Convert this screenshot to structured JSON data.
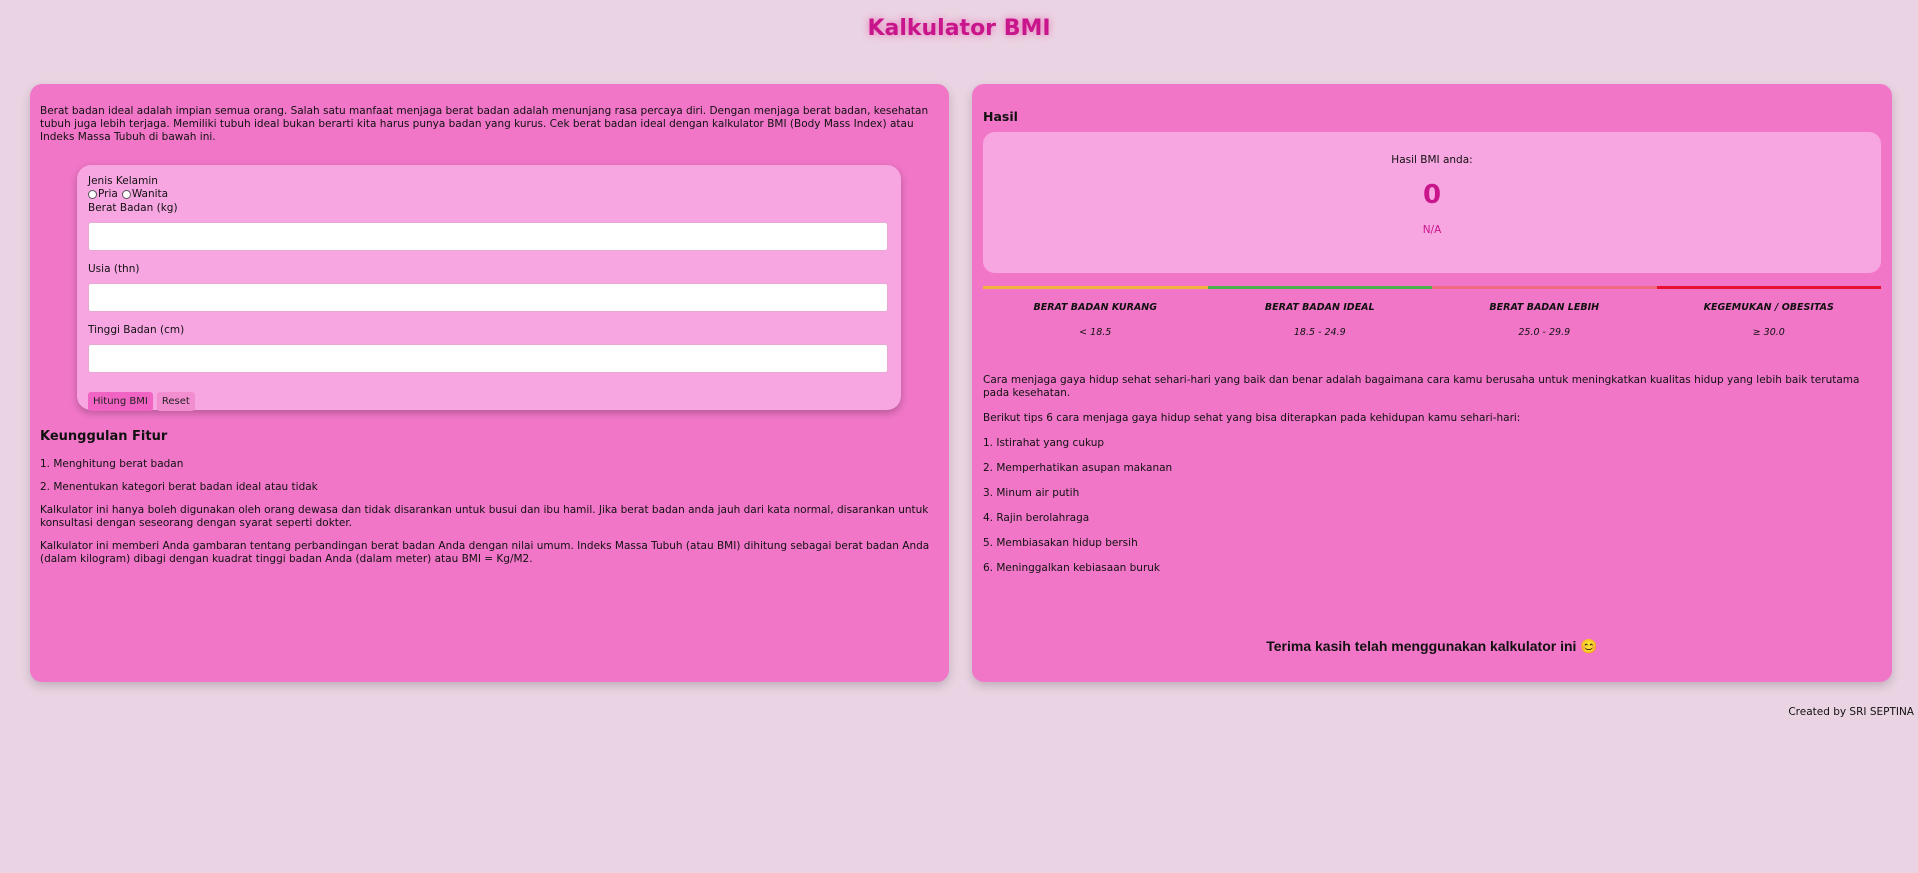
{
  "app": {
    "title": "Kalkulator BMI"
  },
  "left": {
    "intro": "Berat badan ideal adalah impian semua orang. Salah satu manfaat menjaga berat badan adalah menunjang rasa percaya diri. Dengan menjaga berat badan, kesehatan tubuh juga lebih terjaga. Memiliki tubuh ideal bukan berarti kita harus punya badan yang kurus. Cek berat badan ideal dengan kalkulator BMI (Body Mass Index) atau Indeks Massa Tubuh di bawah ini.",
    "form": {
      "gender_label": "Jenis Kelamin",
      "gender_options": [
        "Pria",
        "Wanita"
      ],
      "weight_label": "Berat Badan (kg)",
      "weight_value": "",
      "age_label": "Usia (thn)",
      "age_value": "",
      "height_label": "Tinggi Badan (cm)",
      "height_value": "",
      "calculate_button": "Hitung BMI",
      "reset_button": "Reset"
    },
    "features": {
      "title": "Keunggulan Fitur",
      "items": [
        "1. Menghitung berat badan",
        "2. Menentukan kategori berat badan ideal atau tidak"
      ],
      "note1": "Kalkulator ini hanya boleh digunakan oleh orang dewasa dan tidak disarankan untuk busui dan ibu hamil. Jika berat badan anda jauh dari kata normal, disarankan untuk konsultasi dengan seseorang dengan syarat seperti dokter.",
      "note2": "Kalkulator ini memberi Anda gambaran tentang perbandingan berat badan Anda dengan nilai umum. Indeks Massa Tubuh (atau BMI) dihitung sebagai berat badan Anda (dalam kilogram) dibagi dengan kuadrat tinggi badan Anda (dalam meter) atau BMI = Kg/M2."
    }
  },
  "right": {
    "title": "Hasil",
    "result": {
      "label": "Hasil BMI anda:",
      "value": "0",
      "category": "N/A"
    },
    "scale": [
      {
        "name": "BERAT BADAN KURANG",
        "range": "< 18.5",
        "color": "#f2b33d"
      },
      {
        "name": "BERAT BADAN IDEAL",
        "range": "18.5 - 24.9",
        "color": "#4caf50"
      },
      {
        "name": "BERAT BADAN LEBIH",
        "range": "25.0 - 29.9",
        "color": "#f06b7f"
      },
      {
        "name": "KEGEMUKAN / OBESITAS",
        "range": "≥ 30.0",
        "color": "#e8102f"
      }
    ],
    "tips": {
      "intro": "Cara menjaga gaya hidup sehat sehari-hari yang baik dan benar adalah bagaimana cara kamu berusaha untuk meningkatkan kualitas hidup yang lebih baik terutama pada kesehatan.",
      "lead": "Berikut tips 6 cara menjaga gaya hidup sehat yang bisa diterapkan pada kehidupan kamu sehari-hari:",
      "items": [
        "1. Istirahat yang cukup",
        "2. Memperhatikan asupan makanan",
        "3. Minum air putih",
        "4. Rajin berolahraga",
        "5. Membiasakan hidup bersih",
        "6. Meninggalkan kebiasaan buruk"
      ]
    },
    "thanks": "Terima kasih telah menggunakan kalkulator ini 😊"
  },
  "footer": {
    "credit": "Created by SRI SEPTINA"
  }
}
